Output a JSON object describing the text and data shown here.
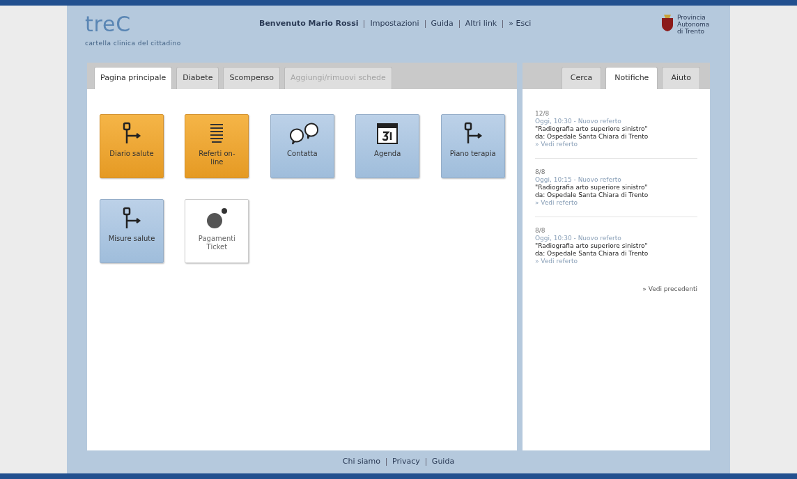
{
  "header": {
    "logo": "treC",
    "subtitle": "cartella clinica del cittadino",
    "welcome": "Benvenuto Mario Rossi",
    "links": [
      "Impostazioni",
      "Guida",
      "Altri link",
      "» Esci"
    ],
    "emblem": "Provincia Autonoma di Trento"
  },
  "main_tabs": [
    {
      "label": "Pagina principale",
      "selected": true,
      "disabled": false
    },
    {
      "label": "Diabete",
      "selected": false,
      "disabled": false
    },
    {
      "label": "Scompenso",
      "selected": false,
      "disabled": false
    },
    {
      "label": "Aggiungi/rimuovi schede",
      "selected": false,
      "disabled": true
    }
  ],
  "tiles": [
    {
      "label": "Diario salute",
      "kind": "orange"
    },
    {
      "label": "Referti on-line",
      "kind": "orange"
    },
    {
      "label": "Contatta",
      "kind": "blue"
    },
    {
      "label": "Agenda",
      "kind": "blue"
    },
    {
      "label": "Piano terapia",
      "kind": "blue"
    },
    {
      "label": "Misure salute",
      "kind": "blue"
    },
    {
      "label": "Pagamenti Ticket",
      "kind": "plain"
    }
  ],
  "side_tabs": [
    {
      "label": "Cerca",
      "selected": false
    },
    {
      "label": "Notifiche",
      "selected": true
    },
    {
      "label": "Aiuto",
      "selected": false
    }
  ],
  "notifications": [
    {
      "date": "12/8",
      "meta": "Oggi, 10:30 - Nuovo referto",
      "title": "\"Radiografia arto superiore sinistro\"",
      "source": "da: Ospedale Santa Chiara di Trento",
      "link": "» Vedi referto"
    },
    {
      "date": "8/8",
      "meta": "Oggi, 10:15 - Nuovo referto",
      "title": "\"Radiografia arto superiore sinistro\"",
      "source": "da: Ospedale Santa Chiara di Trento",
      "link": "» Vedi referto"
    },
    {
      "date": "8/8",
      "meta": "Oggi, 10:30 - Nuovo referto",
      "title": "\"Radiografia arto superiore sinistro\"",
      "source": "da: Ospedale Santa Chiara di Trento",
      "link": "» Vedi referto"
    }
  ],
  "more_link": "» Vedi precedenti",
  "footer": [
    "Chi siamo",
    "Privacy",
    "Guida"
  ]
}
